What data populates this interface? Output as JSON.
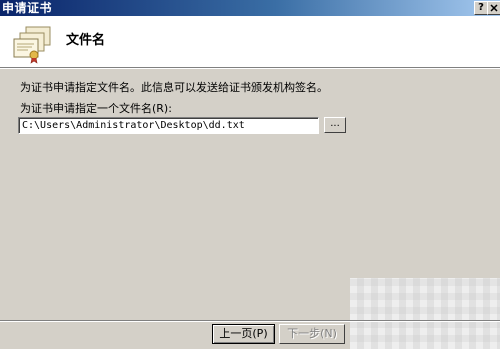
{
  "window": {
    "title": "申请证书",
    "help_label": "?"
  },
  "header": {
    "title": "文件名",
    "icon": "certificate-stack-icon"
  },
  "main": {
    "description": "为证书申请指定文件名。此信息可以发送给证书颁发机构签名。",
    "field_label": "为证书申请指定一个文件名(R):",
    "file_value": "C:\\Users\\Administrator\\Desktop\\dd.txt",
    "browse_label": "..."
  },
  "footer": {
    "back_label": "上一页(P)",
    "next_label": "下一步(N)"
  },
  "colors": {
    "dialog_bg": "#d4d0c8",
    "title_gradient_start": "#0a246a",
    "title_gradient_end": "#a6caf0",
    "disabled_text": "#808080"
  }
}
